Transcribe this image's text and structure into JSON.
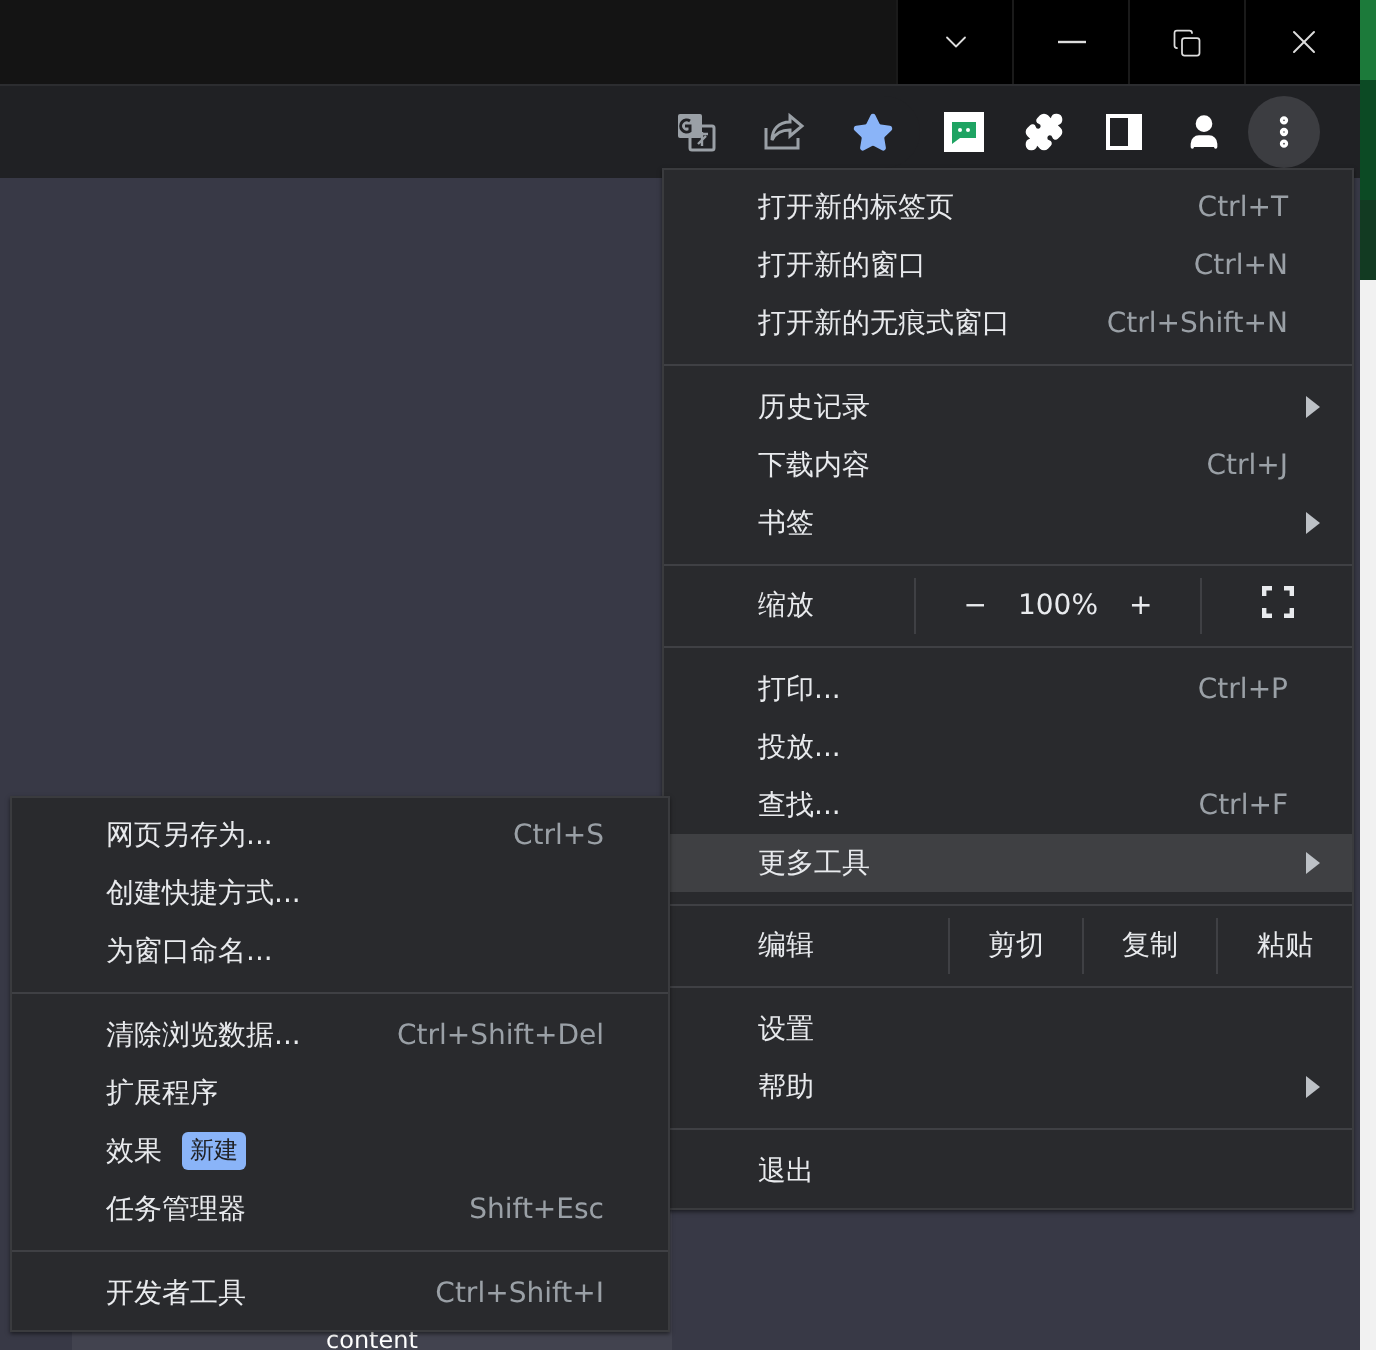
{
  "page": {
    "text": "content"
  },
  "menu": {
    "sections": [
      {
        "items": [
          {
            "kind": "item",
            "label": "打开新的标签页",
            "shortcut": "Ctrl+T",
            "submenu": false,
            "highlighted": false
          },
          {
            "kind": "item",
            "label": "打开新的窗口",
            "shortcut": "Ctrl+N",
            "submenu": false,
            "highlighted": false
          },
          {
            "kind": "item",
            "label": "打开新的无痕式窗口",
            "shortcut": "Ctrl+Shift+N",
            "submenu": false,
            "highlighted": false
          }
        ]
      },
      {
        "items": [
          {
            "kind": "item",
            "label": "历史记录",
            "submenu": true,
            "highlighted": false
          },
          {
            "kind": "item",
            "label": "下载内容",
            "shortcut": "Ctrl+J",
            "submenu": false,
            "highlighted": false
          },
          {
            "kind": "item",
            "label": "书签",
            "submenu": true,
            "highlighted": false
          }
        ]
      },
      {
        "items": [
          {
            "kind": "zoom",
            "label": "缩放",
            "minus": "−",
            "value": "100%",
            "plus": "+"
          }
        ]
      },
      {
        "items": [
          {
            "kind": "item",
            "label": "打印...",
            "shortcut": "Ctrl+P",
            "submenu": false,
            "highlighted": false
          },
          {
            "kind": "item",
            "label": "投放...",
            "submenu": false,
            "highlighted": false
          },
          {
            "kind": "item",
            "label": "查找...",
            "shortcut": "Ctrl+F",
            "submenu": false,
            "highlighted": false
          },
          {
            "kind": "item",
            "label": "更多工具",
            "submenu": true,
            "highlighted": true
          }
        ]
      },
      {
        "items": [
          {
            "kind": "edit",
            "label": "编辑",
            "actions": [
              "剪切",
              "复制",
              "粘贴"
            ]
          }
        ]
      },
      {
        "items": [
          {
            "kind": "item",
            "label": "设置",
            "submenu": false,
            "highlighted": false
          },
          {
            "kind": "item",
            "label": "帮助",
            "submenu": true,
            "highlighted": false
          }
        ]
      },
      {
        "items": [
          {
            "kind": "item",
            "label": "退出",
            "submenu": false,
            "highlighted": false
          }
        ]
      }
    ]
  },
  "submenu": {
    "sections": [
      {
        "items": [
          {
            "kind": "item",
            "label": "网页另存为...",
            "shortcut": "Ctrl+S"
          },
          {
            "kind": "item",
            "label": "创建快捷方式..."
          },
          {
            "kind": "item",
            "label": "为窗口命名..."
          }
        ]
      },
      {
        "items": [
          {
            "kind": "item",
            "label": "清除浏览数据...",
            "shortcut": "Ctrl+Shift+Del"
          },
          {
            "kind": "item",
            "label": "扩展程序"
          },
          {
            "kind": "item",
            "label": "效果",
            "badge": "新建"
          },
          {
            "kind": "item",
            "label": "任务管理器",
            "shortcut": "Shift+Esc"
          }
        ]
      },
      {
        "items": [
          {
            "kind": "item",
            "label": "开发者工具",
            "shortcut": "Ctrl+Shift+I"
          }
        ]
      }
    ]
  }
}
